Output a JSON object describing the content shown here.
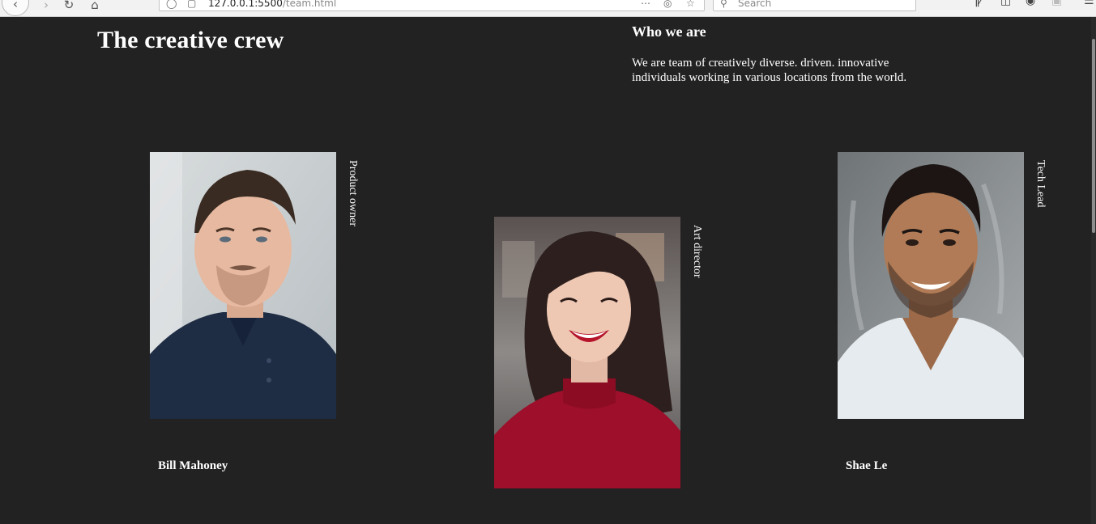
{
  "browser": {
    "url_path": "127.0.0.1:5500/team.html",
    "search_placeholder": "Search"
  },
  "page": {
    "title": "The creative crew",
    "about": {
      "heading": "Who we are",
      "text": "We are team of creatively diverse. driven. innovative individuals working in various locations from the world."
    }
  },
  "members": [
    {
      "role": "Product owner",
      "name": "Bill Mahoney"
    },
    {
      "role": "Art director",
      "name": ""
    },
    {
      "role": "Tech Lead",
      "name": "Shae Le"
    }
  ],
  "icons": {
    "back": "back-arrow-icon",
    "forward": "forward-arrow-icon",
    "reload": "reload-icon",
    "home": "home-icon",
    "page_info": "shield-icon",
    "lock": "lock-icon",
    "more": "ellipsis-icon",
    "pocket": "pocket-icon",
    "bookmark": "star-icon",
    "search": "search-icon",
    "library": "library-icon",
    "sidebar": "sidebar-icon",
    "account": "account-icon",
    "menu": "hamburger-menu-icon"
  },
  "colors": {
    "background": "#222222",
    "text": "#ffffff"
  }
}
